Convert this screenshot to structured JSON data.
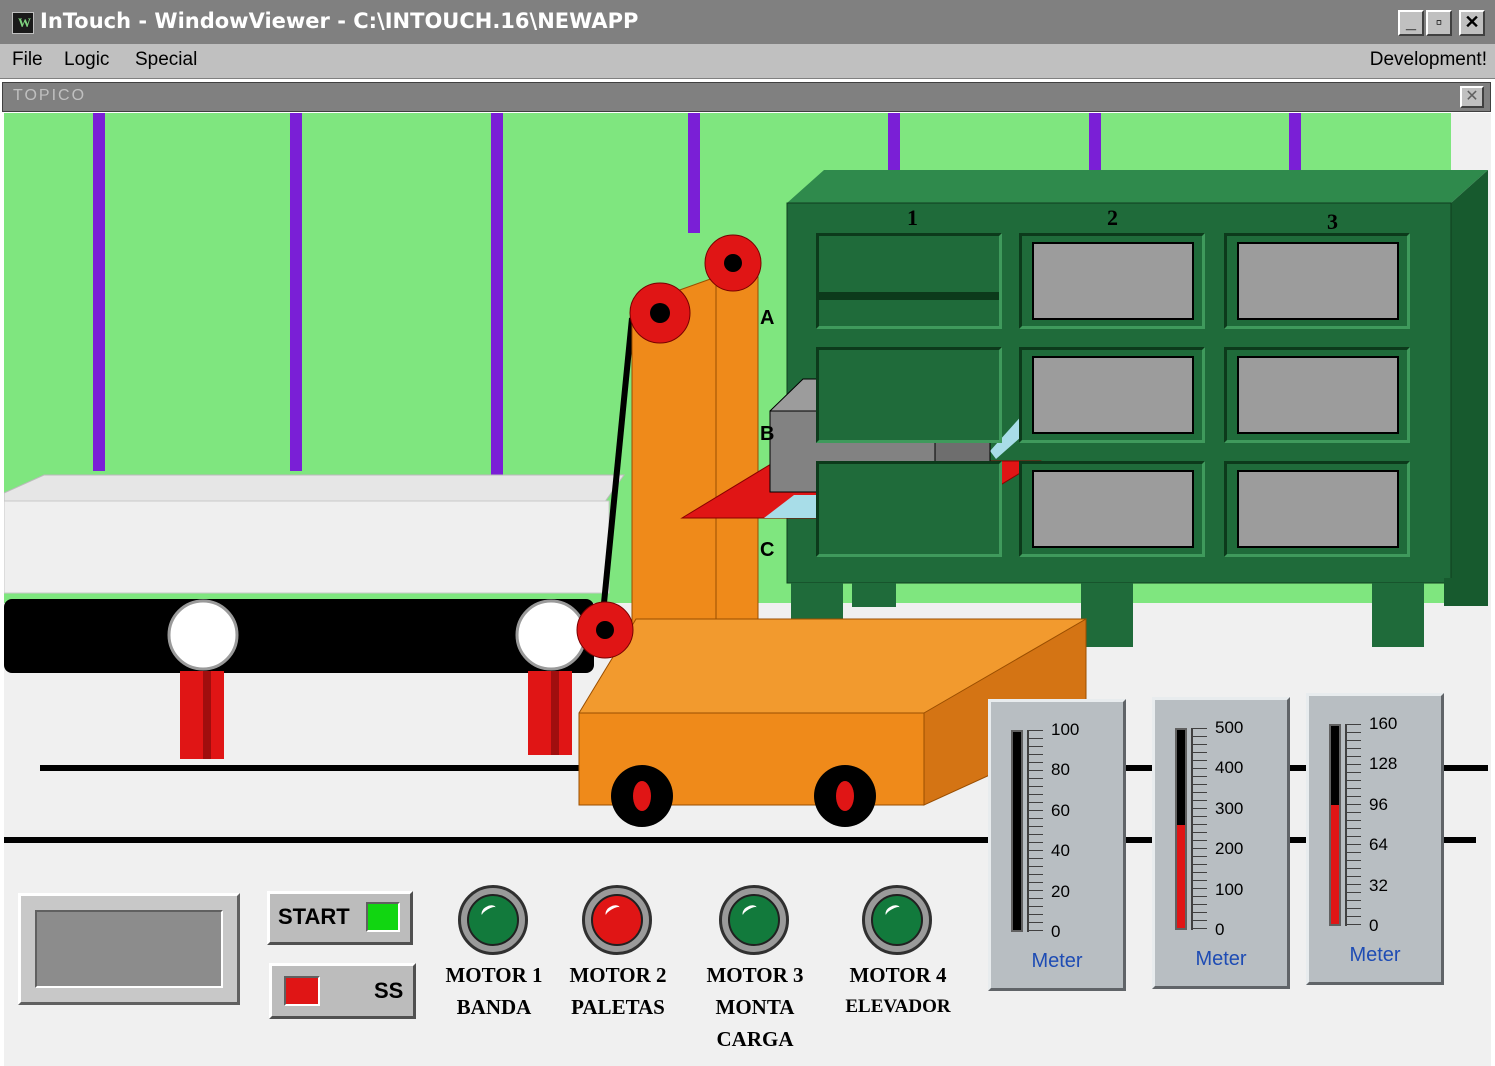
{
  "window": {
    "title": "InTouch - WindowViewer - C:\\INTOUCH.16\\NEWAPP",
    "min_glyph": "_",
    "max_glyph": "▫",
    "close_glyph": "✕"
  },
  "menu": {
    "items": [
      "File",
      "Logic",
      "Special"
    ],
    "mode": "Development!"
  },
  "subwindow": {
    "name": "TOPICO",
    "close_glyph": "✕"
  },
  "rack": {
    "columns": [
      "1",
      "2",
      "3"
    ],
    "rows": [
      "A",
      "B",
      "C"
    ],
    "color": "#1f6b3a"
  },
  "controls": {
    "start_label": "START",
    "stop_label": "SS",
    "start_indicator_color": "#11d611",
    "stop_indicator_color": "#e01515"
  },
  "motors": [
    {
      "line1": "MOTOR 1",
      "line2": "BANDA",
      "line3": "",
      "state": "on",
      "color": "#127a3c"
    },
    {
      "line1": "MOTOR 2",
      "line2": "PALETAS",
      "line3": "",
      "state": "alarm",
      "color": "#e01515"
    },
    {
      "line1": "MOTOR 3",
      "line2": "MONTA",
      "line3": "CARGA",
      "state": "on",
      "color": "#127a3c"
    },
    {
      "line1": "MOTOR 4",
      "line2": "ELEVADOR",
      "line3": "",
      "state": "on",
      "color": "#127a3c"
    }
  ],
  "meters": [
    {
      "label": "Meter",
      "ticks": [
        "100",
        "80",
        "60",
        "40",
        "20",
        "0"
      ],
      "min": 0,
      "max": 100,
      "value": 0,
      "fill": "#000000"
    },
    {
      "label": "Meter",
      "ticks": [
        "500",
        "400",
        "300",
        "200",
        "100",
        "0"
      ],
      "min": 0,
      "max": 500,
      "value": 260,
      "fill": "#e01515"
    },
    {
      "label": "Meter",
      "ticks": [
        "160",
        "128",
        "96",
        "64",
        "32",
        "0"
      ],
      "min": 0,
      "max": 160,
      "value": 96,
      "fill": "#e01515"
    }
  ],
  "colors": {
    "wall": "#7fe67f",
    "pillar": "#7a1fd6",
    "floor": "#f0f0f0",
    "forklift": "#ef8a1a",
    "wheel": "#e01515",
    "panel": "#b8bec2"
  }
}
